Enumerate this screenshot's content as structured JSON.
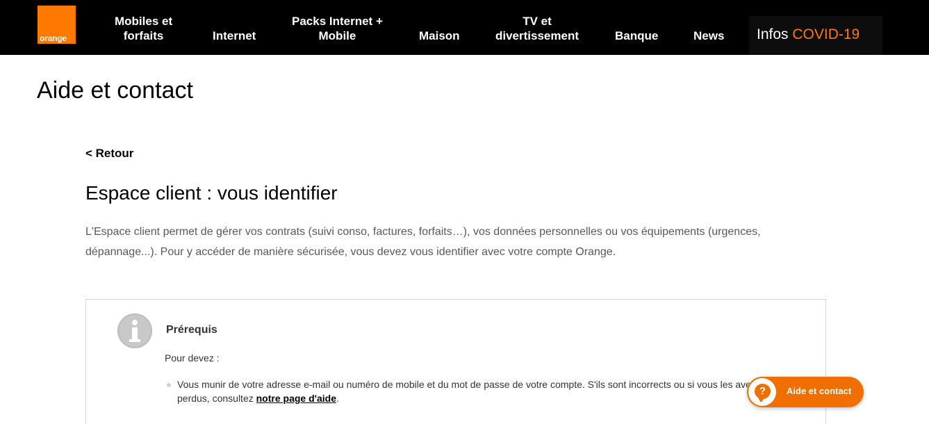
{
  "header": {
    "logo_text": "orange",
    "nav": [
      {
        "line1": "Mobiles et",
        "line2": "forfaits"
      },
      {
        "line1": "",
        "line2": "Internet"
      },
      {
        "line1": "Packs Internet +",
        "line2": "Mobile"
      },
      {
        "line1": "",
        "line2": "Maison"
      },
      {
        "line1": "TV et",
        "line2": "divertissement"
      },
      {
        "line1": "",
        "line2": "Banque"
      },
      {
        "line1": "",
        "line2": "News"
      }
    ],
    "covid": {
      "prefix": "Infos ",
      "highlight": "COVID-19"
    }
  },
  "colors": {
    "brand": "#ff7900",
    "nav_bg": "#000000",
    "chat_bg": "#f16e00"
  },
  "page": {
    "title": "Aide et contact",
    "back_label": "< Retour",
    "article_title": "Espace client : vous identifier",
    "intro": "L'Espace client permet de gérer vos contrats (suivi conso, factures, forfaits…), vos données personnelles ou vos équipements (urgences, dépannage...). Pour y accéder de manière sécurisée, vous devez vous identifier avec votre compte Orange."
  },
  "prerequis": {
    "icon": "info-icon",
    "title": "Prérequis",
    "lead": "Pour devez :",
    "item_text_1": "Vous munir de votre adresse e-mail ou numéro de mobile et du mot de passe de votre compte. S'ils sont incorrects ou si vous les avez",
    "item_text_2": "perdus, consultez ",
    "item_link": "notre page d'aide",
    "item_end": "."
  },
  "chat": {
    "icon": "help-chat-icon",
    "icon_glyph": "?",
    "label": "Aide et contact"
  }
}
